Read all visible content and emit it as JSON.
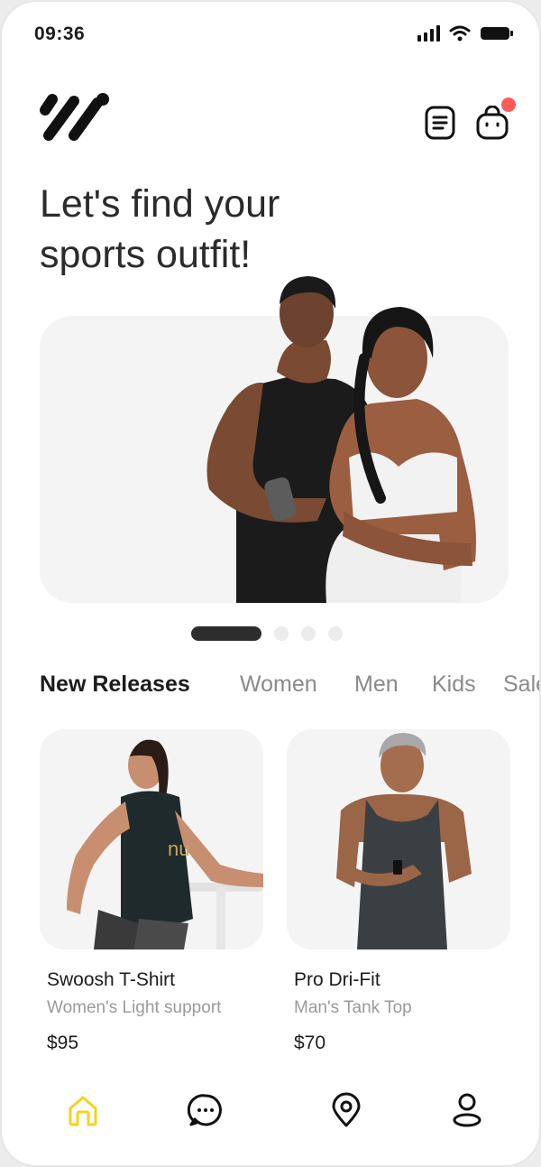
{
  "status_bar": {
    "time": "09:36"
  },
  "headline": {
    "line1": "Let's find your",
    "line2": "sports outfit!"
  },
  "carousel": {
    "slides": 4,
    "active_index": 0
  },
  "tabs": [
    {
      "label": "New Releases",
      "active": true
    },
    {
      "label": "Women",
      "active": false
    },
    {
      "label": "Men",
      "active": false
    },
    {
      "label": "Kids",
      "active": false
    },
    {
      "label": "Sale",
      "active": false
    }
  ],
  "products": [
    {
      "name": "Swoosh T-Shirt",
      "subtitle": "Women's Light support",
      "price": "$95"
    },
    {
      "name": "Pro Dri-Fit",
      "subtitle": "Man's Tank Top",
      "price": "$70"
    }
  ],
  "nav": [
    {
      "icon": "home-icon",
      "active": true
    },
    {
      "icon": "chat-icon",
      "active": false
    },
    {
      "icon": "location-icon",
      "active": false
    },
    {
      "icon": "profile-icon",
      "active": false
    }
  ],
  "colors": {
    "accent": "#f5d21e",
    "badge": "#ff5a5a",
    "card_bg": "#f4f4f4",
    "dark": "#2d2d2d"
  }
}
